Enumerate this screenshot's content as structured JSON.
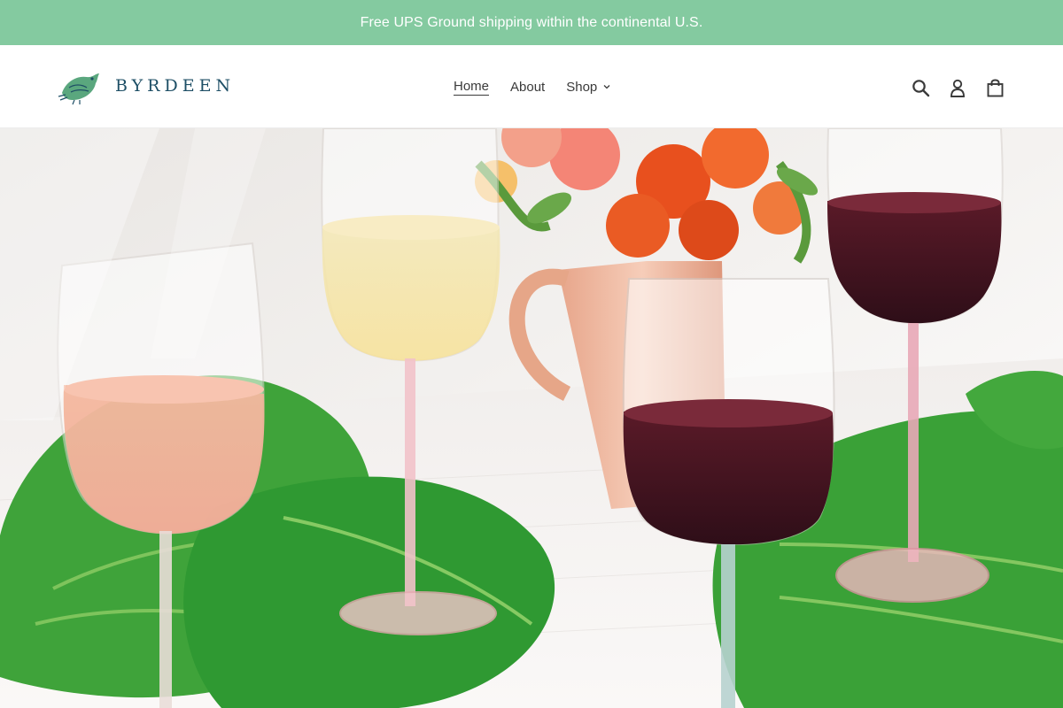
{
  "announcement": {
    "text": "Free UPS Ground shipping within the continental U.S."
  },
  "brand": {
    "name": "BYRDEEN",
    "logo_icon": "bird-icon",
    "color": "#1e4f66"
  },
  "nav": {
    "items": [
      {
        "label": "Home",
        "active": true
      },
      {
        "label": "About",
        "active": false
      },
      {
        "label": "Shop",
        "active": false,
        "has_dropdown": true
      }
    ]
  },
  "header_icons": [
    "search-icon",
    "account-icon",
    "cart-icon"
  ],
  "hero": {
    "image": "colored-stem-wine-glasses-with-flowers-and-monstera-leaves"
  },
  "colors": {
    "announcement_bg": "#84caa0",
    "text": "#3a3a3a"
  }
}
